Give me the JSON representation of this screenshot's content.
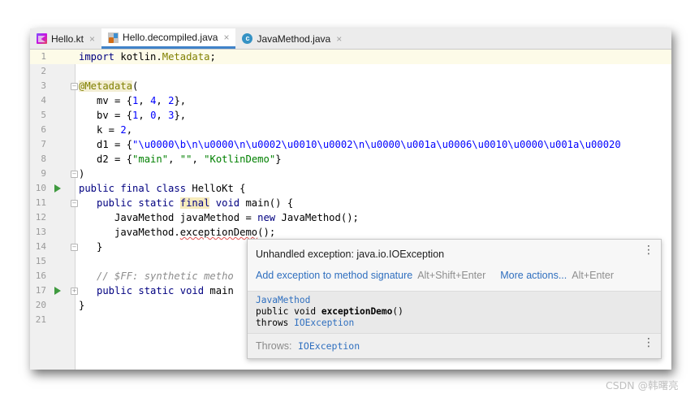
{
  "tabs": [
    {
      "label": "Hello.kt",
      "icon": "kotlin-file-icon",
      "active": false
    },
    {
      "label": "Hello.decompiled.java",
      "icon": "java-class-file-icon",
      "active": true
    },
    {
      "label": "JavaMethod.java",
      "icon": "java-file-icon",
      "active": false
    }
  ],
  "close_glyph": "×",
  "line_numbers": [
    "1",
    "2",
    "3",
    "4",
    "5",
    "6",
    "7",
    "8",
    "9",
    "10",
    "11",
    "12",
    "13",
    "14",
    "15",
    "16",
    "17",
    "20",
    "21"
  ],
  "code": {
    "l1_kw": "import",
    "l1_rest": " kotlin.",
    "l1_cls": "Metadata",
    "l1_end": ";",
    "l3_ann": "@Metadata",
    "l3_end": "(",
    "l4_a": "   mv = {",
    "l4_n1": "1",
    "l4_c1": ", ",
    "l4_n2": "4",
    "l4_c2": ", ",
    "l4_n3": "2",
    "l4_end": "},",
    "l5_a": "   bv = {",
    "l5_n1": "1",
    "l5_c1": ", ",
    "l5_n2": "0",
    "l5_c2": ", ",
    "l5_n3": "3",
    "l5_end": "},",
    "l6_a": "   k = ",
    "l6_n": "2",
    "l6_end": ",",
    "l7_a": "   d1 = {",
    "l7_str": "\"\\u0000\\b\\n\\u0000\\n\\u0002\\u0010\\u0002\\n\\u0000\\u001a\\u0006\\u0010\\u0000\\u001a\\u00020",
    "l8_a": "   d2 = {",
    "l8_s1": "\"main\"",
    "l8_c1": ", ",
    "l8_s2": "\"\"",
    "l8_c2": ", ",
    "l8_s3": "\"KotlinDemo\"",
    "l8_end": "}",
    "l9": ")",
    "l10_kw": "public final class",
    "l10_rest": " HelloKt {",
    "l11_kw1": "   public static ",
    "l11_kw2": "final",
    "l11_kw3": " void",
    "l11_rest": " main() {",
    "l12_a": "      JavaMethod javaMethod = ",
    "l12_kw": "new",
    "l12_rest": " JavaMethod();",
    "l13_a": "      javaMethod.",
    "l13_err": "exceptionDemo",
    "l13_rest": "();",
    "l14": "   }",
    "l16_cm": "   // $FF: synthetic metho",
    "l17_kw": "   public static void",
    "l17_rest": " main",
    "l20": "}"
  },
  "popup": {
    "title": "Unhandled exception: java.io.IOException",
    "action1": "Add exception to method signature",
    "action1_shortcut": "Alt+Shift+Enter",
    "action2": "More actions...",
    "action2_shortcut": "Alt+Enter",
    "doc_class": "JavaMethod",
    "doc_sig_a": "public void ",
    "doc_sig_b": "exceptionDemo",
    "doc_sig_c": "()",
    "doc_throws_a": "throws ",
    "doc_throws_b": "IOException",
    "throws_label": "Throws:",
    "throws_value": "IOException",
    "menu_glyph": "⋮"
  },
  "watermark": "CSDN @韩曙亮",
  "colors": {
    "accent": "#4083c9",
    "keyword": "#000080",
    "number": "#0000ff",
    "string": "#008000",
    "annotation": "#808000",
    "link": "#2f6fbf"
  }
}
